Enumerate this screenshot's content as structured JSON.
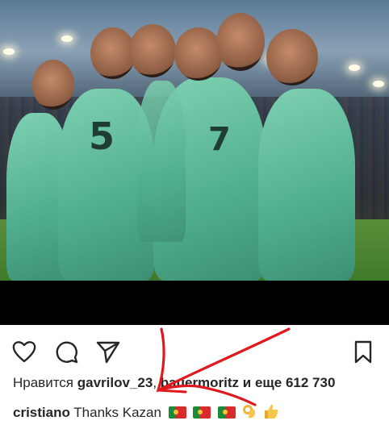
{
  "post": {
    "photo_alt": "",
    "likes": {
      "prefix": "Нравится",
      "user1": "gavrilov_23",
      "user2": "bauermoritz",
      "conjunction": "и еще",
      "count": "612 730"
    },
    "caption": {
      "username": "cristiano",
      "text": "Thanks Kazan",
      "emojis": [
        "flag-portugal",
        "flag-portugal",
        "flag-portugal",
        "ok-hand",
        "thumbs-up"
      ]
    }
  },
  "icons": {
    "like": "heart-icon",
    "comment": "comment-icon",
    "share": "send-icon",
    "save": "bookmark-icon"
  },
  "colors": {
    "text": "#262626",
    "annotation": "#e0191f",
    "jersey": "#5fbf9c"
  }
}
